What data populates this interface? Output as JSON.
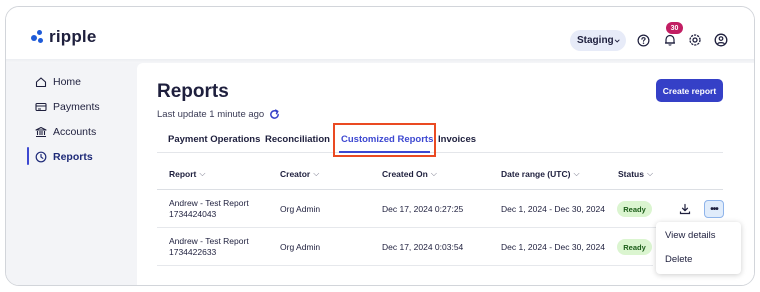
{
  "brand": {
    "name": "ripple",
    "accent": "#1e5bd8"
  },
  "topbar": {
    "environment": "Staging",
    "notifications_count": "30",
    "icons": [
      "chevron-down-icon",
      "help-icon",
      "bell-icon",
      "gear-icon",
      "user-icon"
    ]
  },
  "sidebar": {
    "items": [
      {
        "label": "Home",
        "icon": "home-icon"
      },
      {
        "label": "Payments",
        "icon": "payments-icon"
      },
      {
        "label": "Accounts",
        "icon": "bank-icon"
      },
      {
        "label": "Reports",
        "icon": "reports-icon",
        "active": true
      }
    ]
  },
  "page": {
    "title": "Reports",
    "last_update": "Last update 1 minute ago",
    "create_label": "Create report"
  },
  "tabs": [
    {
      "label": "Payment Operations"
    },
    {
      "label": "Reconciliation"
    },
    {
      "label": "Customized Reports",
      "active": true
    },
    {
      "label": "Invoices"
    }
  ],
  "table": {
    "columns": [
      "Report",
      "Creator",
      "Created On",
      "Date range (UTC)",
      "Status"
    ],
    "rows": [
      {
        "report_line1": "Andrew - Test Report",
        "report_line2": "1734424043",
        "creator": "Org Admin",
        "created_on": "Dec 17, 2024 0:27:25",
        "date_range": "Dec 1, 2024 - Dec 30, 2024",
        "status": "Ready"
      },
      {
        "report_line1": "Andrew - Test Report",
        "report_line2": "1734422633",
        "creator": "Org Admin",
        "created_on": "Dec 17, 2024 0:03:54",
        "date_range": "Dec 1, 2024 - Dec 30, 2024",
        "status": "Ready"
      }
    ]
  },
  "row_menu": {
    "items": [
      "View details",
      "Delete"
    ]
  },
  "colors": {
    "primary": "#3540c7",
    "highlight": "#ea4a22",
    "ready_bg": "#dbf5d0",
    "ready_text": "#1c5d19",
    "badge": "#c21e63"
  }
}
